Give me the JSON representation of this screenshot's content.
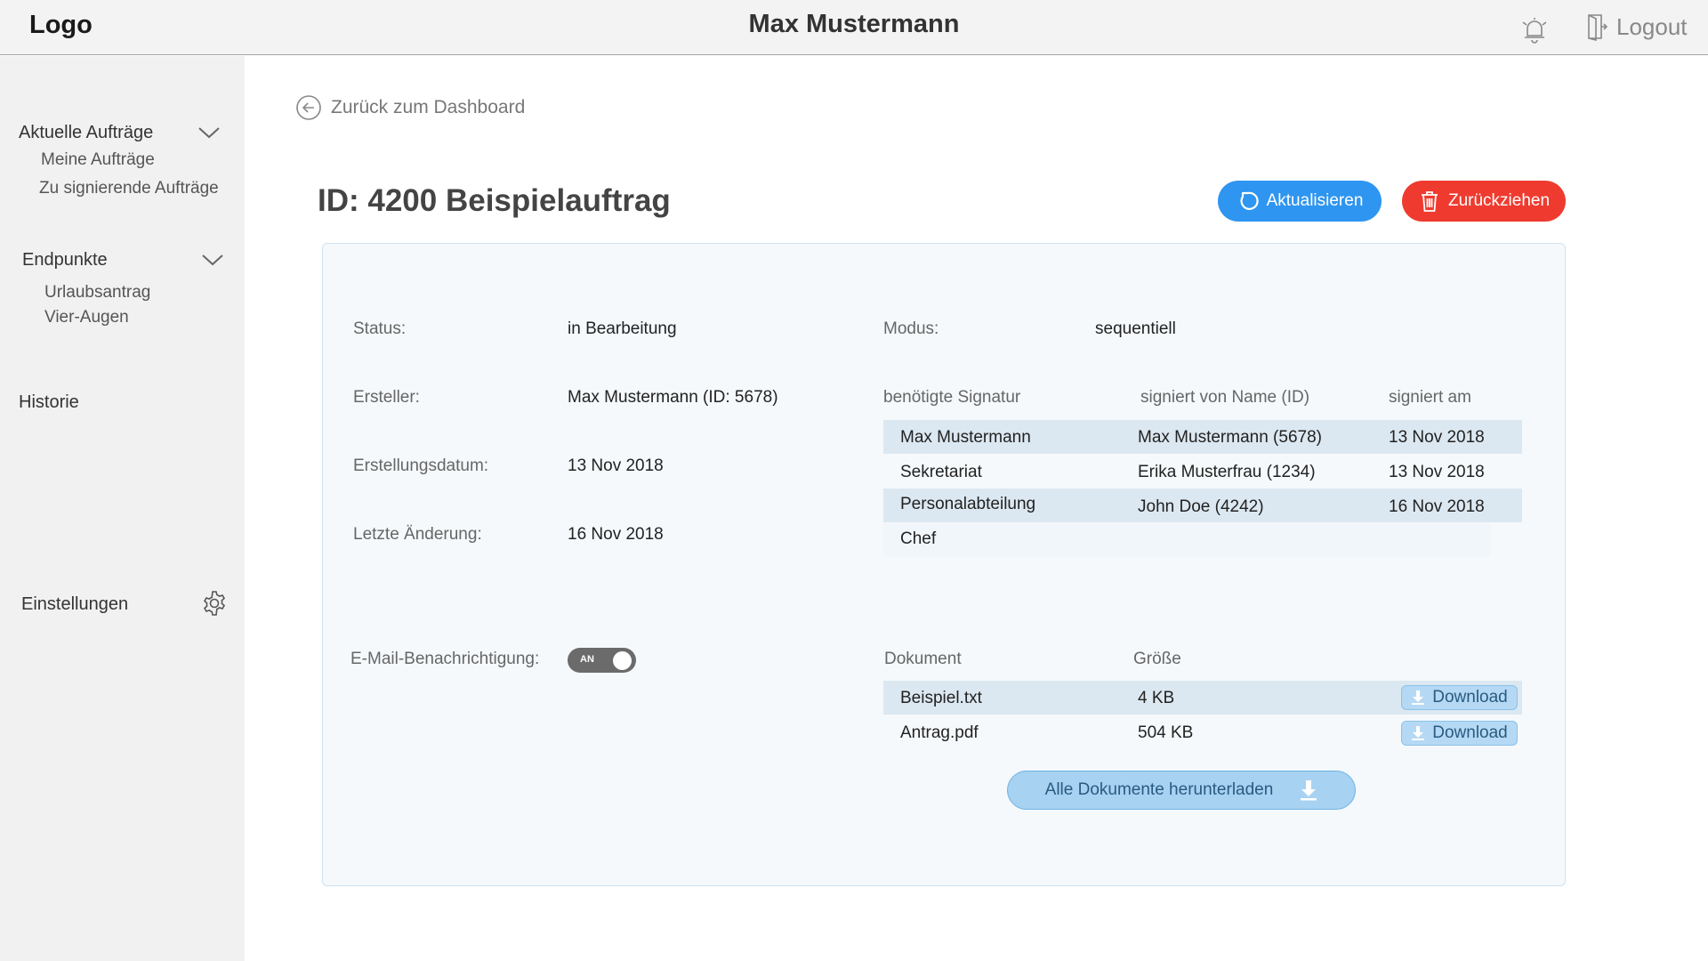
{
  "header": {
    "logo": "Logo",
    "user_name": "Max Mustermann",
    "logout_label": "Logout"
  },
  "sidebar": {
    "groups": [
      {
        "title": "Aktuelle Aufträge",
        "items": [
          "Meine Aufträge",
          "Zu signierende Aufträge"
        ]
      },
      {
        "title": "Endpunkte",
        "items": [
          "Urlaubsantrag",
          "Vier-Augen"
        ]
      }
    ],
    "history": "Historie",
    "settings": "Einstellungen"
  },
  "main": {
    "back_label": "Zurück zum Dashboard",
    "title": "ID: 4200 Beispielauftrag",
    "refresh_label": "Aktualisieren",
    "withdraw_label": "Zurückziehen",
    "refresh_color": "#2e95f0",
    "withdraw_color": "#ef3b2f"
  },
  "details": {
    "status_label": "Status:",
    "status_value": "in Bearbeitung",
    "creator_label": "Ersteller:",
    "creator_value": "Max Mustermann (ID: 5678)",
    "created_label": "Erstellungsdatum:",
    "created_value": "13 Nov 2018",
    "modified_label": "Letzte Änderung:",
    "modified_value": "16 Nov 2018",
    "mode_label": "Modus:",
    "mode_value": "sequentiell",
    "email_label": "E-Mail-Benachrichtigung:",
    "email_toggle_text": "AN",
    "email_toggle_on": true
  },
  "signatures": {
    "headers": [
      "benötigte Signatur",
      "signiert von Name (ID)",
      "signiert am"
    ],
    "rows": [
      [
        "Max Mustermann",
        "Max Mustermann (5678)",
        "13 Nov 2018"
      ],
      [
        "Sekretariat",
        "Erika Musterfrau (1234)",
        "13 Nov 2018"
      ],
      [
        "Personalabteilung",
        "John Doe (4242)",
        "16 Nov 2018"
      ],
      [
        "Chef",
        "",
        ""
      ]
    ]
  },
  "documents": {
    "headers": [
      "Dokument",
      "Größe"
    ],
    "rows": [
      {
        "name": "Beispiel.txt",
        "size": "4 KB",
        "action": "Download"
      },
      {
        "name": "Antrag.pdf",
        "size": "504 KB",
        "action": "Download"
      }
    ],
    "download_all_label": "Alle Dokumente herunterladen"
  }
}
